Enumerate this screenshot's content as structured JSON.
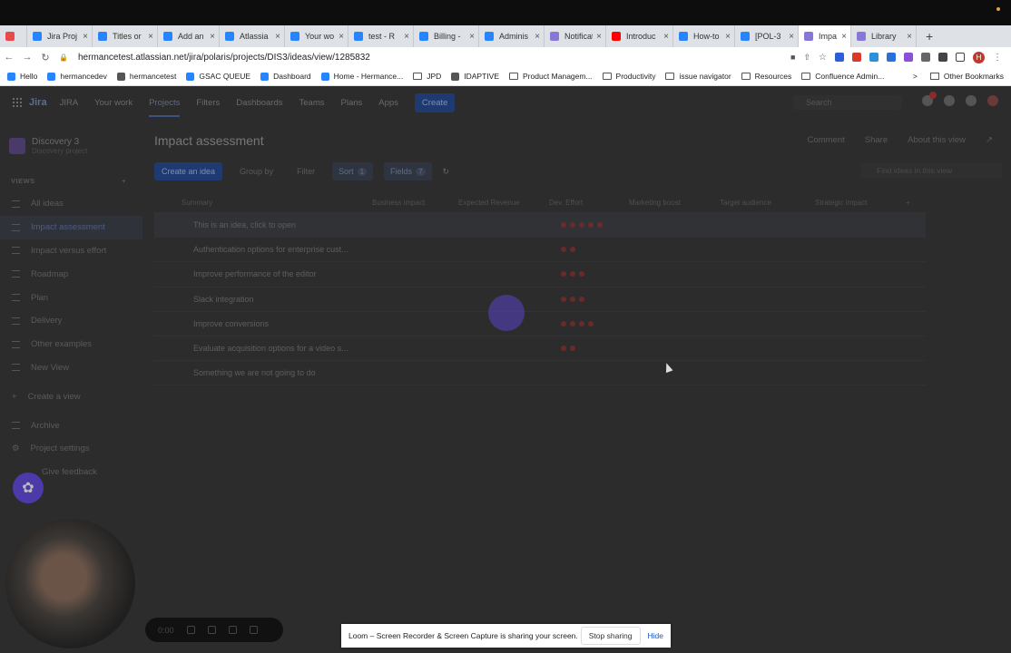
{
  "browser": {
    "tabs": [
      {
        "label": "",
        "color": "#e84a4a"
      },
      {
        "label": "Jira Proj",
        "color": "#2684ff"
      },
      {
        "label": "Titles or",
        "color": "#2684ff"
      },
      {
        "label": "Add an i",
        "color": "#2684ff"
      },
      {
        "label": "Atlassia",
        "color": "#2684ff"
      },
      {
        "label": "Your wo",
        "color": "#2684ff"
      },
      {
        "label": "test - R",
        "color": "#2684ff"
      },
      {
        "label": "Billing -",
        "color": "#2684ff"
      },
      {
        "label": "Adminis",
        "color": "#2684ff"
      },
      {
        "label": "Notificat",
        "color": "#8777d9"
      },
      {
        "label": "Introduc",
        "color": "#ff0000"
      },
      {
        "label": "How-to",
        "color": "#2684ff"
      },
      {
        "label": "[POL-3",
        "color": "#2684ff"
      },
      {
        "label": "Impa",
        "color": "#8777d9",
        "active": true
      },
      {
        "label": "Library",
        "color": "#8777d9"
      }
    ],
    "new_tab": "+",
    "url": "hermancetest.atlassian.net/jira/polaris/projects/DIS3/ideas/view/1285832",
    "profile_initial": "H",
    "bookmarks": [
      {
        "label": "Hello",
        "color": "#2684ff"
      },
      {
        "label": "hermancedev",
        "color": "#2684ff"
      },
      {
        "label": "hermancetest",
        "color": "#555555"
      },
      {
        "label": "GSAC QUEUE",
        "color": "#2684ff"
      },
      {
        "label": "Dashboard",
        "color": "#2684ff"
      },
      {
        "label": "Home - Hermance...",
        "color": "#2684ff"
      },
      {
        "label": "JPD",
        "folder": true
      },
      {
        "label": "IDAPTIVE",
        "color": "#555555"
      },
      {
        "label": "Product Managem...",
        "folder": true
      },
      {
        "label": "Productivity",
        "folder": true
      },
      {
        "label": "issue navigator",
        "folder": true
      },
      {
        "label": "Resources",
        "folder": true
      },
      {
        "label": "Confluence Admin...",
        "folder": true
      }
    ],
    "bookmarks_more": ">",
    "other_bookmarks": "Other Bookmarks"
  },
  "jira": {
    "logo": "Jira",
    "nav": [
      "JIRA",
      "Your work",
      "Projects",
      "Filters",
      "Dashboards",
      "Teams",
      "Plans",
      "Apps"
    ],
    "nav_current": "Projects",
    "create": "Create",
    "search_placeholder": "Search",
    "project_name": "Discovery 3",
    "project_type": "Discovery project",
    "views_heading": "VIEWS",
    "views_add": "+",
    "sidebar": [
      "All ideas",
      "Impact assessment",
      "Impact versus effort",
      "Roadmap",
      "Plan",
      "Delivery",
      "Other examples",
      "New View"
    ],
    "sidebar_current": "Impact assessment",
    "create_view": "Create a view",
    "archive": "Archive",
    "project_settings": "Project settings",
    "give_feedback": "Give feedback",
    "page_title": "Impact assessment",
    "header_actions": [
      "Comment",
      "Share",
      "About this view"
    ],
    "toolbar": {
      "create_idea": "Create an idea",
      "group_by": "Group by",
      "filter": "Filter",
      "sort": "Sort",
      "sort_count": "1",
      "fields": "Fields",
      "fields_count": "7"
    },
    "view_search_placeholder": "Find ideas in this view",
    "columns": [
      "Summary",
      "Business impact",
      "Expected Revenue",
      "Dev. Effort",
      "Marketing boost",
      "Target audience",
      "Strategic impact"
    ],
    "rows": [
      {
        "summary": "This is an idea, click to open",
        "effort": 5
      },
      {
        "summary": "Authentication options for enterprise cust...",
        "effort": 2
      },
      {
        "summary": "Improve performance of the editor",
        "effort": 3
      },
      {
        "summary": "Slack integration",
        "effort": 3
      },
      {
        "summary": "Improve conversions",
        "effort": 4
      },
      {
        "summary": "Evaluate acquisition options for a video s...",
        "effort": 2
      },
      {
        "summary": "Something we are not going to do",
        "effort": 0
      }
    ]
  },
  "recorder": {
    "timer": "0:00",
    "share_message": "Loom – Screen Recorder & Screen Capture is sharing your screen.",
    "stop_sharing": "Stop sharing",
    "hide": "Hide"
  }
}
